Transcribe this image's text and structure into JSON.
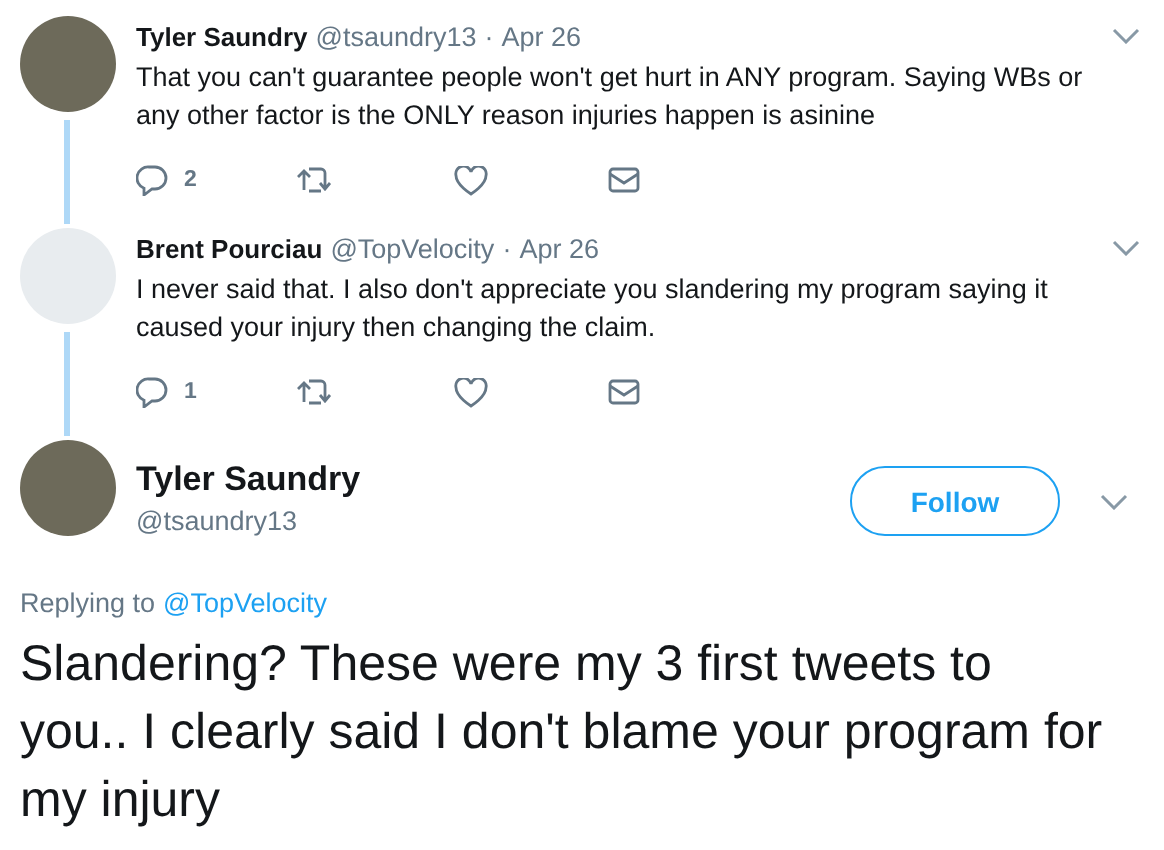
{
  "thread": [
    {
      "name": "Tyler Saundry",
      "handle": "@tsaundry13",
      "separator": "·",
      "date": "Apr 26",
      "text": "That you can't guarantee people won't get hurt in ANY program. Saying WBs or any other factor is the ONLY reason injuries happen is asinine",
      "reply_count": "2"
    },
    {
      "name": "Brent Pourciau",
      "handle": "@TopVelocity",
      "separator": "·",
      "date": "Apr 26",
      "text": "I never said that. I also don't appreciate you slandering my program saying it caused your injury then changing the claim.",
      "reply_count": "1"
    }
  ],
  "main_tweet": {
    "name": "Tyler Saundry",
    "handle": "@tsaundry13",
    "follow_button": "Follow",
    "replying_label": "Replying to",
    "replying_to": "@TopVelocity",
    "text": "Slandering? These were my 3 first tweets to you.. I clearly said I don't blame your program for my injury"
  }
}
